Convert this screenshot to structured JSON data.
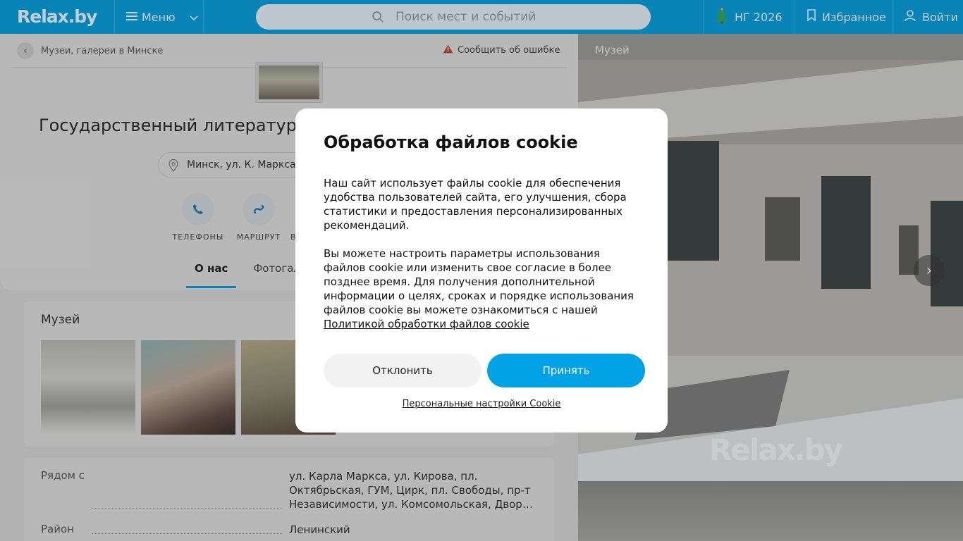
{
  "header": {
    "logo": "Relax.by",
    "menu_label": "Меню",
    "search_placeholder": "Поиск мест и событий",
    "ng_label": "НГ 2026",
    "favorites_label": "Избранное",
    "login_label": "Войти"
  },
  "page": {
    "breadcrumb": "Музеи, галереи в Минске",
    "report_error": "Сообщить об ошибке",
    "title": "Государственный литератур",
    "address": "Минск, ул. К. Маркса",
    "actions": [
      {
        "label": "ТЕЛЕФОНЫ",
        "icon": "phone-icon"
      },
      {
        "label": "МАРШРУТ",
        "icon": "route-icon"
      },
      {
        "label": "В",
        "icon": "bookmark-icon"
      }
    ],
    "tabs": [
      {
        "label": "О нас",
        "active": true
      },
      {
        "label": "Фотогале",
        "active": false
      }
    ],
    "museum_section_title": "Музей",
    "info": {
      "near_label": "Рядом с",
      "near_value": "ул. Карла Маркса, ул. Кирова, пл. Октябрьская, ГУМ, Цирк, пл. Свободы, пр-т Независимости, ул. Комсомольская, Двор…",
      "district_label": "Район",
      "district_value": "Ленинский"
    }
  },
  "photo_panel": {
    "label": "Музей",
    "watermark": "Relax.by"
  },
  "cookie_modal": {
    "title": "Обработка файлов cookie",
    "paragraph1": "Наш сайт использует файлы cookie для обеспечения удобства пользователей сайта, его улучшения, сбора статистики и предоставления персонализированных рекомендаций.",
    "paragraph2": "Вы можете настроить параметры использования файлов cookie или изменить свое согласие в более позднее время. Для получения дополнительной информации о целях, сроках и порядке использования файлов cookie вы можете ознакомиться с нашей",
    "policy_link": "Политикой обработки файлов cookie",
    "decline_label": "Отклонить",
    "accept_label": "Принять",
    "personal_settings": "Персональные настройки Cookie"
  },
  "colors": {
    "brand_blue": "#0a9ed9",
    "accept_button": "#00a2e6"
  }
}
